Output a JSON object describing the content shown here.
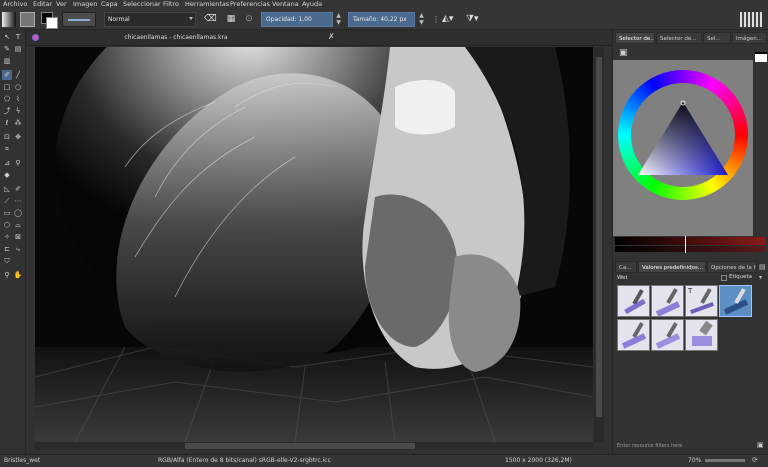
{
  "menu": [
    "Archivo",
    "Editar",
    "Ver",
    "Imagen",
    "Capa",
    "Seleccionar",
    "Filtro",
    "Herramientas",
    "Preferencias",
    "Ventana",
    "Ayuda"
  ],
  "toolbar": {
    "blend_mode": "Normal",
    "opacity_label": "Opacidad: 1,00",
    "size_label": "Tamaño: 40,22 px"
  },
  "document": {
    "tab_title": "chicaenllamas - chicaenllamas.kra"
  },
  "dock": {
    "top_tabs": [
      "Selector de...",
      "Selector de...",
      "Sel...",
      "Imágen..."
    ],
    "bottom_tabs": [
      "Ca...",
      "Valores predefinidos...",
      "Opciones de la he..."
    ],
    "preset_tag": "Wet",
    "tag_label": "Etiqueta",
    "filter_placeholder": "Enter resource filters here"
  },
  "status": {
    "brush_name": "Bristles_wet",
    "color_info": "RGB/Alfa (Entero de 8 bits/canal)  sRGB-elle-V2-srgbtrc.icc",
    "dimensions": "1500 x 2000 (326,2M)",
    "zoom": "70%"
  },
  "colors": {
    "accent": "#4a6a8d",
    "selected_preset": "#5c8fc4"
  }
}
